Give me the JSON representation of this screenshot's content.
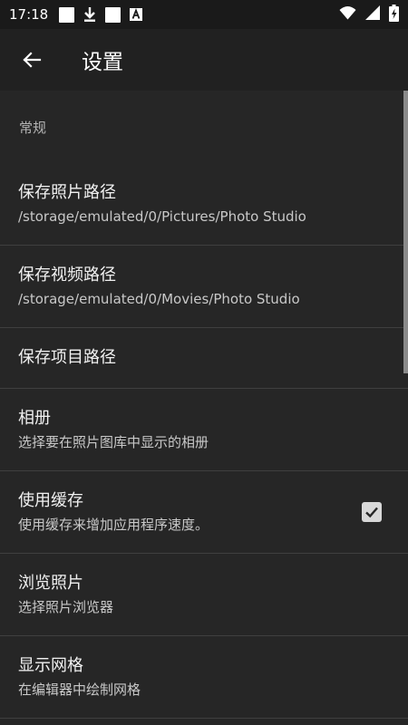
{
  "status_bar": {
    "time": "17:18",
    "icons": [
      "notification-square-icon",
      "download-icon",
      "notification-square-icon",
      "a-icon",
      "wifi-icon",
      "signal-icon",
      "battery-charging-icon"
    ]
  },
  "app_bar": {
    "back_icon": "arrow-left-icon",
    "title": "设置"
  },
  "settings": {
    "section_general": "常规",
    "items": [
      {
        "title": "保存照片路径",
        "summary": "/storage/emulated/0/Pictures/Photo Studio"
      },
      {
        "title": "保存视频路径",
        "summary": "/storage/emulated/0/Movies/Photo Studio"
      },
      {
        "title": "保存项目路径",
        "summary": ""
      },
      {
        "title": "相册",
        "summary": "选择要在照片图库中显示的相册"
      },
      {
        "title": "使用缓存",
        "summary": "使用缓存来增加应用程序速度。",
        "checked": true
      },
      {
        "title": "浏览照片",
        "summary": "选择照片浏览器"
      },
      {
        "title": "显示网格",
        "summary": "在编辑器中绘制网格"
      }
    ]
  },
  "colors": {
    "background": "#262626",
    "app_bar": "#212121",
    "status_bar": "#1a1a1a",
    "divider": "#3f3f3f"
  }
}
